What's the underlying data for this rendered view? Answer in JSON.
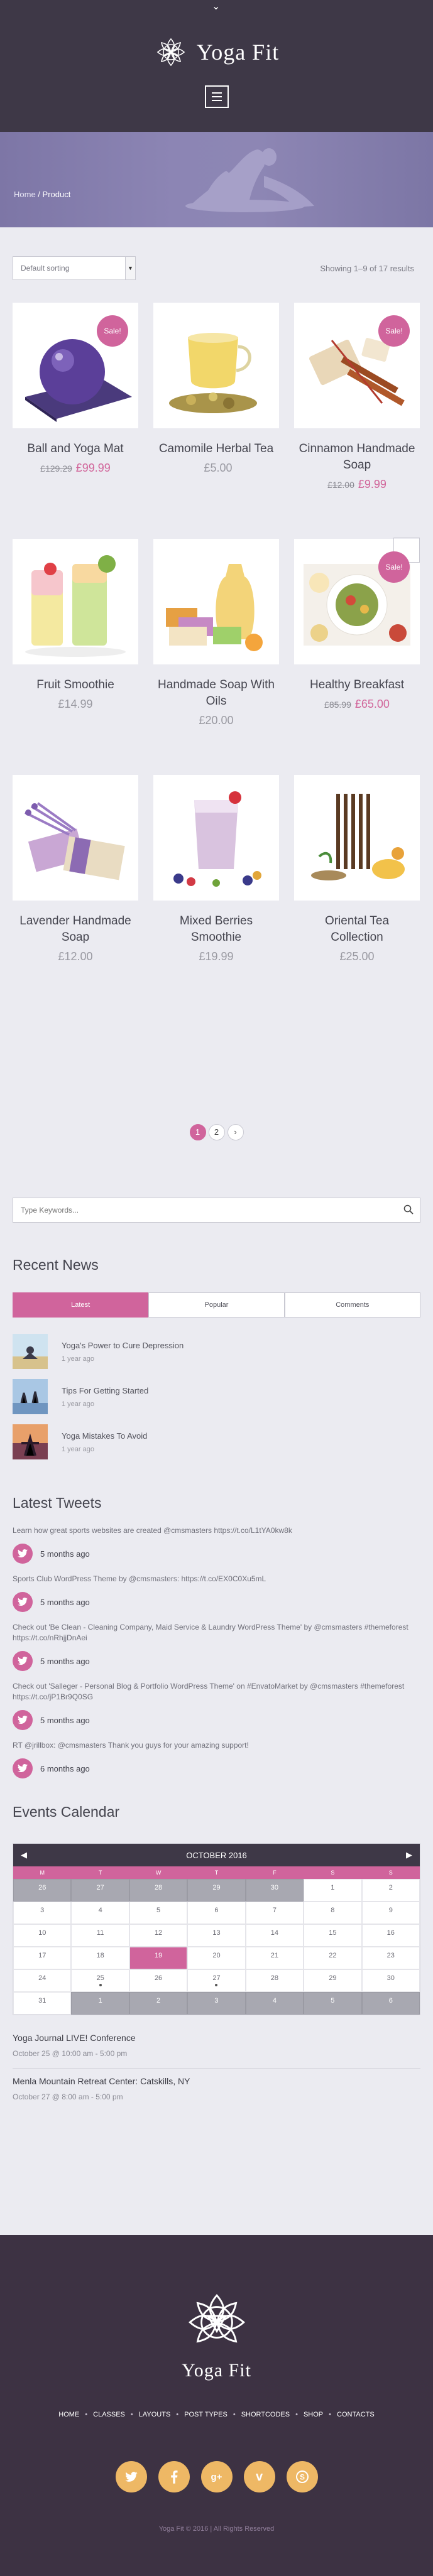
{
  "header": {
    "brand": "Yoga Fit"
  },
  "breadcrumb": {
    "home": "Home",
    "sep": " / ",
    "current": "Product"
  },
  "shop": {
    "sort_label": "Default sorting",
    "result_count": "Showing 1–9 of 17 results",
    "sale_label": "Sale!",
    "products": [
      {
        "name": "Ball and Yoga Mat",
        "old_price": "£129.29",
        "price": "£99.99",
        "sale": true
      },
      {
        "name": "Camomile Herbal Tea",
        "old_price": "",
        "price": "£5.00",
        "sale": false
      },
      {
        "name": "Cinnamon Handmade Soap",
        "old_price": "£12.00",
        "price": "£9.99",
        "sale": true
      },
      {
        "name": "Fruit Smoothie",
        "old_price": "",
        "price": "£14.99",
        "sale": false
      },
      {
        "name": "Handmade Soap With Oils",
        "old_price": "",
        "price": "£20.00",
        "sale": false
      },
      {
        "name": "Healthy Breakfast",
        "old_price": "£85.99",
        "price": "£65.00",
        "sale": true
      },
      {
        "name": "Lavender Handmade Soap",
        "old_price": "",
        "price": "£12.00",
        "sale": false
      },
      {
        "name": "Mixed Berries Smoothie",
        "old_price": "",
        "price": "£19.99",
        "sale": false
      },
      {
        "name": "Oriental Tea Collection",
        "old_price": "",
        "price": "£25.00",
        "sale": false
      }
    ],
    "pagination": {
      "pages": [
        "1",
        "2"
      ],
      "current": "1",
      "next": "›"
    }
  },
  "sidebar": {
    "search_placeholder": "Type Keywords...",
    "recent_news": {
      "title": "Recent News",
      "tabs": [
        "Latest",
        "Popular",
        "Comments"
      ],
      "items": [
        {
          "title": "Yoga's Power to Cure Depression",
          "date": "1 year ago"
        },
        {
          "title": "Tips For Getting Started",
          "date": "1 year ago"
        },
        {
          "title": "Yoga Mistakes To Avoid",
          "date": "1 year ago"
        }
      ]
    },
    "tweets": {
      "title": "Latest Tweets",
      "items": [
        {
          "text": "Learn how great sports websites are created @cmsmasters https://t.co/L1tYA0kw8k",
          "date": "5 months ago"
        },
        {
          "text": "Sports Club WordPress Theme by @cmsmasters: https://t.co/EX0C0Xu5mL",
          "date": "5 months ago"
        },
        {
          "text": "Check out 'Be Clean - Cleaning Company, Maid Service & Laundry WordPress Theme' by @cmsmasters #themeforest https://t.co/nRhjjDnAei",
          "date": "5 months ago"
        },
        {
          "text": "Check out 'Salleger - Personal Blog & Portfolio WordPress Theme' on #EnvatoMarket by @cmsmasters #themeforest https://t.co/jP1Br9Q0SG",
          "date": "5 months ago"
        },
        {
          "text": "RT @jrillbox: @cmsmasters Thank you guys for your amazing support!",
          "date": "6 months ago"
        }
      ]
    },
    "calendar": {
      "title": "Events Calendar",
      "month": "OCTOBER 2016",
      "days": [
        "M",
        "T",
        "W",
        "T",
        "F",
        "S",
        "S"
      ],
      "weeks": [
        [
          "26",
          "27",
          "28",
          "29",
          "30",
          "1",
          "2"
        ],
        [
          "3",
          "4",
          "5",
          "6",
          "7",
          "8",
          "9"
        ],
        [
          "10",
          "11",
          "12",
          "13",
          "14",
          "15",
          "16"
        ],
        [
          "17",
          "18",
          "19",
          "20",
          "21",
          "22",
          "23"
        ],
        [
          "24",
          "25",
          "26",
          "27",
          "28",
          "29",
          "30"
        ],
        [
          "31",
          "1",
          "2",
          "3",
          "4",
          "5",
          "6"
        ]
      ],
      "events": [
        {
          "title": "Yoga Journal LIVE! Conference",
          "date": "October 25 @ 10:00 am - 5:00 pm"
        },
        {
          "title": "Menla Mountain Retreat Center: Catskills, NY",
          "date": "October 27 @ 8:00 am - 5:00 pm"
        }
      ]
    }
  },
  "footer": {
    "brand": "Yoga Fit",
    "nav": [
      "HOME",
      "CLASSES",
      "LAYOUTS",
      "POST TYPES",
      "SHORTCODES",
      "SHOP",
      "CONTACTS"
    ],
    "social": [
      "twitter-icon",
      "facebook-icon",
      "google-plus-icon",
      "vimeo-icon",
      "skype-icon"
    ],
    "copyright": "Yoga Fit © 2016 | All Rights Reserved"
  },
  "colors": {
    "accent": "#d0649c",
    "header_bg": "#3e3847",
    "footer_bg": "#3d3243",
    "social_bg": "#eeb865",
    "banner": "#8c85b4"
  }
}
